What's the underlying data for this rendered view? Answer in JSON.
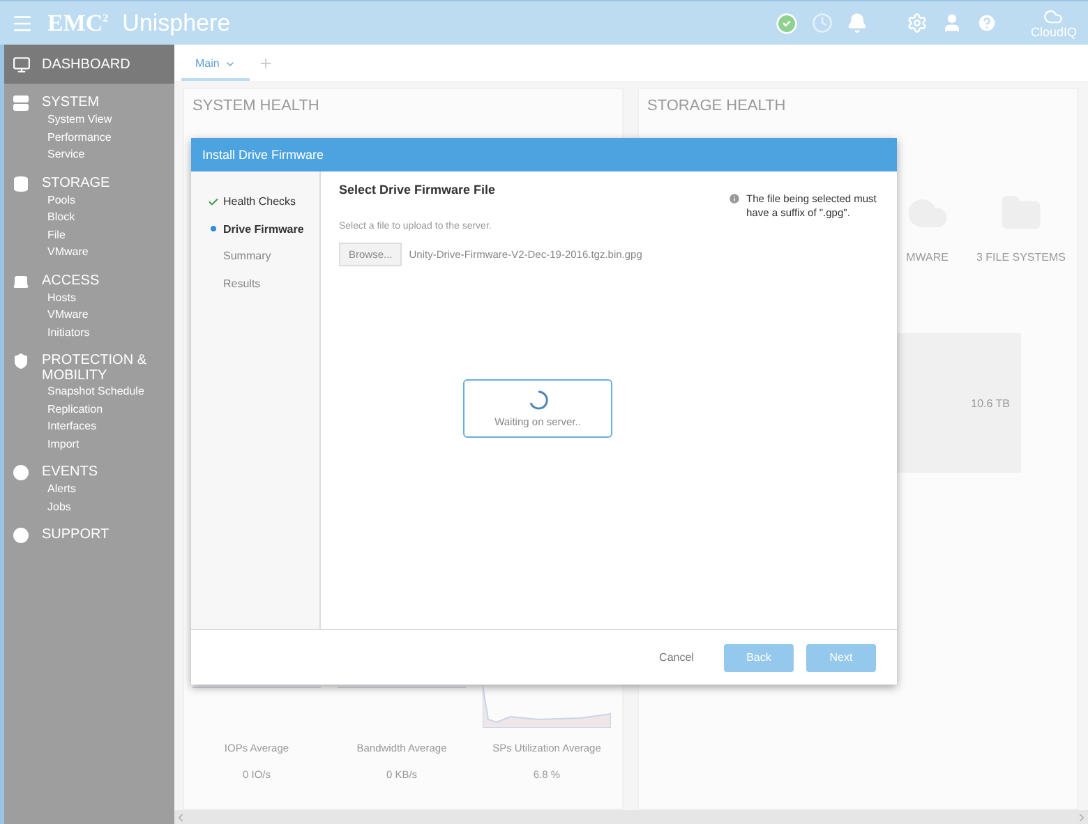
{
  "header": {
    "logo": "EMC",
    "logo_sup": "2",
    "product": "Unisphere",
    "cloud_label": "CloudIQ"
  },
  "sidebar": {
    "dashboard": {
      "label": "DASHBOARD",
      "selected": true
    },
    "sections": [
      {
        "title": "SYSTEM",
        "items": [
          "System View",
          "Performance",
          "Service"
        ]
      },
      {
        "title": "STORAGE",
        "items": [
          "Pools",
          "Block",
          "File",
          "VMware"
        ]
      },
      {
        "title": "ACCESS",
        "items": [
          "Hosts",
          "VMware",
          "Initiators"
        ]
      },
      {
        "title": "PROTECTION & MOBILITY",
        "items": [
          "Snapshot Schedule",
          "Replication",
          "Interfaces",
          "Import"
        ]
      },
      {
        "title": "EVENTS",
        "items": [
          "Alerts",
          "Jobs"
        ]
      },
      {
        "title": "SUPPORT"
      }
    ]
  },
  "tabs": [
    {
      "label": "Main",
      "selected": true
    }
  ],
  "system_health": {
    "title": "SYSTEM HEALTH"
  },
  "storage_health": {
    "title": "STORAGE HEALTH",
    "labels": [
      "MWARE",
      "3 FILE SYSTEMS"
    ]
  },
  "capacity": {
    "reading": "10.6 TB"
  },
  "performance": [
    {
      "label": "IOPs Average",
      "value": "0 IO/s"
    },
    {
      "label": "Bandwidth Average",
      "value": "0 KB/s"
    },
    {
      "label": "SPs Utilization Average",
      "value": "6.8 %"
    }
  ],
  "dialog": {
    "title": "Install Drive Firmware",
    "steps": [
      {
        "label": "Health Checks",
        "done": true,
        "selected": false
      },
      {
        "label": "Drive Firmware",
        "done": false,
        "selected": true
      },
      {
        "label": "Summary",
        "done": false,
        "selected": false
      },
      {
        "label": "Results",
        "done": false,
        "selected": false
      }
    ],
    "heading": "Select Drive Firmware File",
    "hint": "Select a file to upload to the server.",
    "browse": "Browse...",
    "file_name": "Unity-Drive-Firmware-V2-Dec-19-2016.tgz.bin.gpg",
    "info": "The file being selected must have a suffix of \".gpg\".",
    "loading": "Waiting on server..",
    "buttons": [
      {
        "label": "Cancel",
        "kind": "link",
        "disabled": false
      },
      {
        "label": "Back",
        "kind": "primary",
        "disabled": true
      },
      {
        "label": "Next",
        "kind": "primary",
        "disabled": true
      }
    ]
  }
}
